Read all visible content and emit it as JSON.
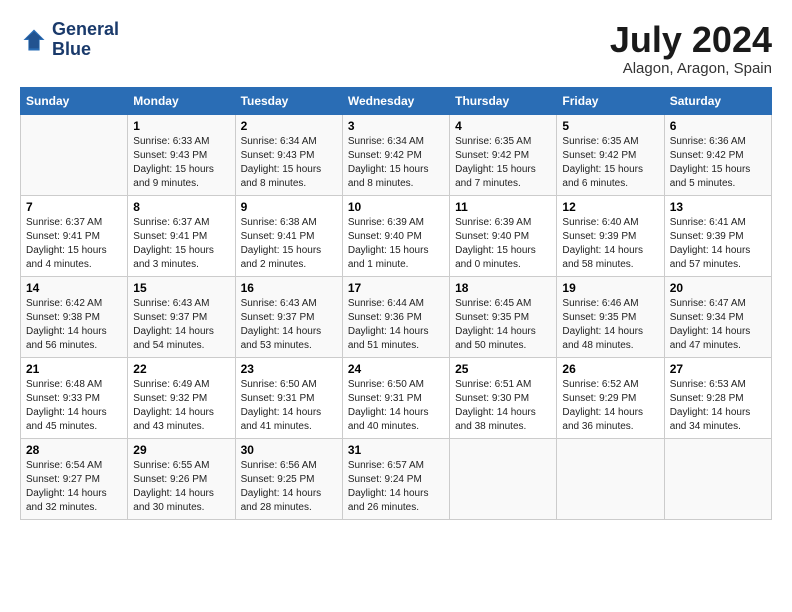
{
  "header": {
    "logo_line1": "General",
    "logo_line2": "Blue",
    "month_year": "July 2024",
    "location": "Alagon, Aragon, Spain"
  },
  "weekdays": [
    "Sunday",
    "Monday",
    "Tuesday",
    "Wednesday",
    "Thursday",
    "Friday",
    "Saturday"
  ],
  "weeks": [
    [
      {
        "day": "",
        "sunrise": "",
        "sunset": "",
        "daylight": ""
      },
      {
        "day": "1",
        "sunrise": "Sunrise: 6:33 AM",
        "sunset": "Sunset: 9:43 PM",
        "daylight": "Daylight: 15 hours and 9 minutes."
      },
      {
        "day": "2",
        "sunrise": "Sunrise: 6:34 AM",
        "sunset": "Sunset: 9:43 PM",
        "daylight": "Daylight: 15 hours and 8 minutes."
      },
      {
        "day": "3",
        "sunrise": "Sunrise: 6:34 AM",
        "sunset": "Sunset: 9:42 PM",
        "daylight": "Daylight: 15 hours and 8 minutes."
      },
      {
        "day": "4",
        "sunrise": "Sunrise: 6:35 AM",
        "sunset": "Sunset: 9:42 PM",
        "daylight": "Daylight: 15 hours and 7 minutes."
      },
      {
        "day": "5",
        "sunrise": "Sunrise: 6:35 AM",
        "sunset": "Sunset: 9:42 PM",
        "daylight": "Daylight: 15 hours and 6 minutes."
      },
      {
        "day": "6",
        "sunrise": "Sunrise: 6:36 AM",
        "sunset": "Sunset: 9:42 PM",
        "daylight": "Daylight: 15 hours and 5 minutes."
      }
    ],
    [
      {
        "day": "7",
        "sunrise": "Sunrise: 6:37 AM",
        "sunset": "Sunset: 9:41 PM",
        "daylight": "Daylight: 15 hours and 4 minutes."
      },
      {
        "day": "8",
        "sunrise": "Sunrise: 6:37 AM",
        "sunset": "Sunset: 9:41 PM",
        "daylight": "Daylight: 15 hours and 3 minutes."
      },
      {
        "day": "9",
        "sunrise": "Sunrise: 6:38 AM",
        "sunset": "Sunset: 9:41 PM",
        "daylight": "Daylight: 15 hours and 2 minutes."
      },
      {
        "day": "10",
        "sunrise": "Sunrise: 6:39 AM",
        "sunset": "Sunset: 9:40 PM",
        "daylight": "Daylight: 15 hours and 1 minute."
      },
      {
        "day": "11",
        "sunrise": "Sunrise: 6:39 AM",
        "sunset": "Sunset: 9:40 PM",
        "daylight": "Daylight: 15 hours and 0 minutes."
      },
      {
        "day": "12",
        "sunrise": "Sunrise: 6:40 AM",
        "sunset": "Sunset: 9:39 PM",
        "daylight": "Daylight: 14 hours and 58 minutes."
      },
      {
        "day": "13",
        "sunrise": "Sunrise: 6:41 AM",
        "sunset": "Sunset: 9:39 PM",
        "daylight": "Daylight: 14 hours and 57 minutes."
      }
    ],
    [
      {
        "day": "14",
        "sunrise": "Sunrise: 6:42 AM",
        "sunset": "Sunset: 9:38 PM",
        "daylight": "Daylight: 14 hours and 56 minutes."
      },
      {
        "day": "15",
        "sunrise": "Sunrise: 6:43 AM",
        "sunset": "Sunset: 9:37 PM",
        "daylight": "Daylight: 14 hours and 54 minutes."
      },
      {
        "day": "16",
        "sunrise": "Sunrise: 6:43 AM",
        "sunset": "Sunset: 9:37 PM",
        "daylight": "Daylight: 14 hours and 53 minutes."
      },
      {
        "day": "17",
        "sunrise": "Sunrise: 6:44 AM",
        "sunset": "Sunset: 9:36 PM",
        "daylight": "Daylight: 14 hours and 51 minutes."
      },
      {
        "day": "18",
        "sunrise": "Sunrise: 6:45 AM",
        "sunset": "Sunset: 9:35 PM",
        "daylight": "Daylight: 14 hours and 50 minutes."
      },
      {
        "day": "19",
        "sunrise": "Sunrise: 6:46 AM",
        "sunset": "Sunset: 9:35 PM",
        "daylight": "Daylight: 14 hours and 48 minutes."
      },
      {
        "day": "20",
        "sunrise": "Sunrise: 6:47 AM",
        "sunset": "Sunset: 9:34 PM",
        "daylight": "Daylight: 14 hours and 47 minutes."
      }
    ],
    [
      {
        "day": "21",
        "sunrise": "Sunrise: 6:48 AM",
        "sunset": "Sunset: 9:33 PM",
        "daylight": "Daylight: 14 hours and 45 minutes."
      },
      {
        "day": "22",
        "sunrise": "Sunrise: 6:49 AM",
        "sunset": "Sunset: 9:32 PM",
        "daylight": "Daylight: 14 hours and 43 minutes."
      },
      {
        "day": "23",
        "sunrise": "Sunrise: 6:50 AM",
        "sunset": "Sunset: 9:31 PM",
        "daylight": "Daylight: 14 hours and 41 minutes."
      },
      {
        "day": "24",
        "sunrise": "Sunrise: 6:50 AM",
        "sunset": "Sunset: 9:31 PM",
        "daylight": "Daylight: 14 hours and 40 minutes."
      },
      {
        "day": "25",
        "sunrise": "Sunrise: 6:51 AM",
        "sunset": "Sunset: 9:30 PM",
        "daylight": "Daylight: 14 hours and 38 minutes."
      },
      {
        "day": "26",
        "sunrise": "Sunrise: 6:52 AM",
        "sunset": "Sunset: 9:29 PM",
        "daylight": "Daylight: 14 hours and 36 minutes."
      },
      {
        "day": "27",
        "sunrise": "Sunrise: 6:53 AM",
        "sunset": "Sunset: 9:28 PM",
        "daylight": "Daylight: 14 hours and 34 minutes."
      }
    ],
    [
      {
        "day": "28",
        "sunrise": "Sunrise: 6:54 AM",
        "sunset": "Sunset: 9:27 PM",
        "daylight": "Daylight: 14 hours and 32 minutes."
      },
      {
        "day": "29",
        "sunrise": "Sunrise: 6:55 AM",
        "sunset": "Sunset: 9:26 PM",
        "daylight": "Daylight: 14 hours and 30 minutes."
      },
      {
        "day": "30",
        "sunrise": "Sunrise: 6:56 AM",
        "sunset": "Sunset: 9:25 PM",
        "daylight": "Daylight: 14 hours and 28 minutes."
      },
      {
        "day": "31",
        "sunrise": "Sunrise: 6:57 AM",
        "sunset": "Sunset: 9:24 PM",
        "daylight": "Daylight: 14 hours and 26 minutes."
      },
      {
        "day": "",
        "sunrise": "",
        "sunset": "",
        "daylight": ""
      },
      {
        "day": "",
        "sunrise": "",
        "sunset": "",
        "daylight": ""
      },
      {
        "day": "",
        "sunrise": "",
        "sunset": "",
        "daylight": ""
      }
    ]
  ]
}
